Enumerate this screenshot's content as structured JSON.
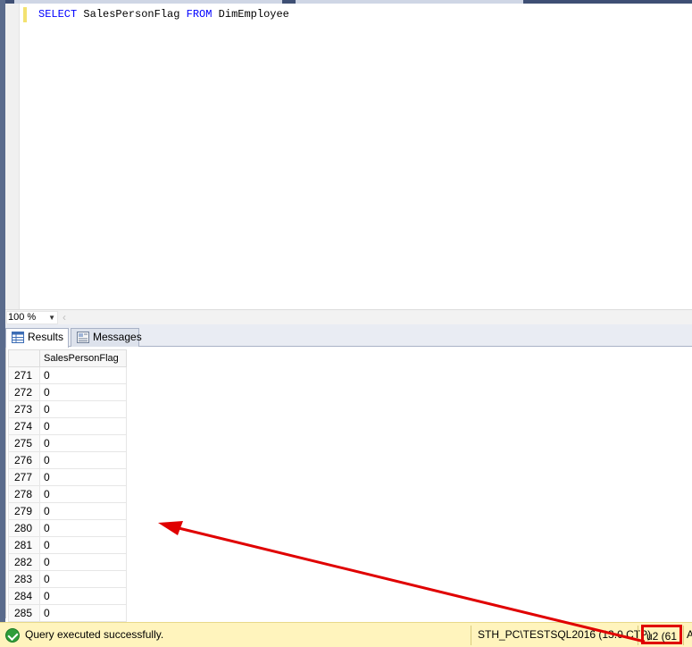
{
  "editor": {
    "query_keyword_select": "SELECT",
    "query_column": "SalesPersonFlag",
    "query_keyword_from": "FROM",
    "query_table": "DimEmployee"
  },
  "zoom": {
    "value": "100 %"
  },
  "results_tabs": {
    "results_label": "Results",
    "messages_label": "Messages"
  },
  "grid": {
    "column_header": "SalesPersonFlag",
    "rows": [
      {
        "num": "271",
        "value": "0"
      },
      {
        "num": "272",
        "value": "0"
      },
      {
        "num": "273",
        "value": "0"
      },
      {
        "num": "274",
        "value": "0"
      },
      {
        "num": "275",
        "value": "0"
      },
      {
        "num": "276",
        "value": "0"
      },
      {
        "num": "277",
        "value": "0"
      },
      {
        "num": "278",
        "value": "0"
      },
      {
        "num": "279",
        "value": "0"
      },
      {
        "num": "280",
        "value": "0"
      },
      {
        "num": "281",
        "value": "0"
      },
      {
        "num": "282",
        "value": "0"
      },
      {
        "num": "283",
        "value": "0"
      },
      {
        "num": "284",
        "value": "0"
      },
      {
        "num": "285",
        "value": "0"
      }
    ]
  },
  "status": {
    "message": "Query executed successfully.",
    "server": "STH_PC\\TESTSQL2016 (13.0 CTP)",
    "user": "u2 (61",
    "more": "A"
  },
  "colors": {
    "status_background": "#fff4bd",
    "annotation_red": "#e00000",
    "keyword_blue": "#0000ff"
  }
}
